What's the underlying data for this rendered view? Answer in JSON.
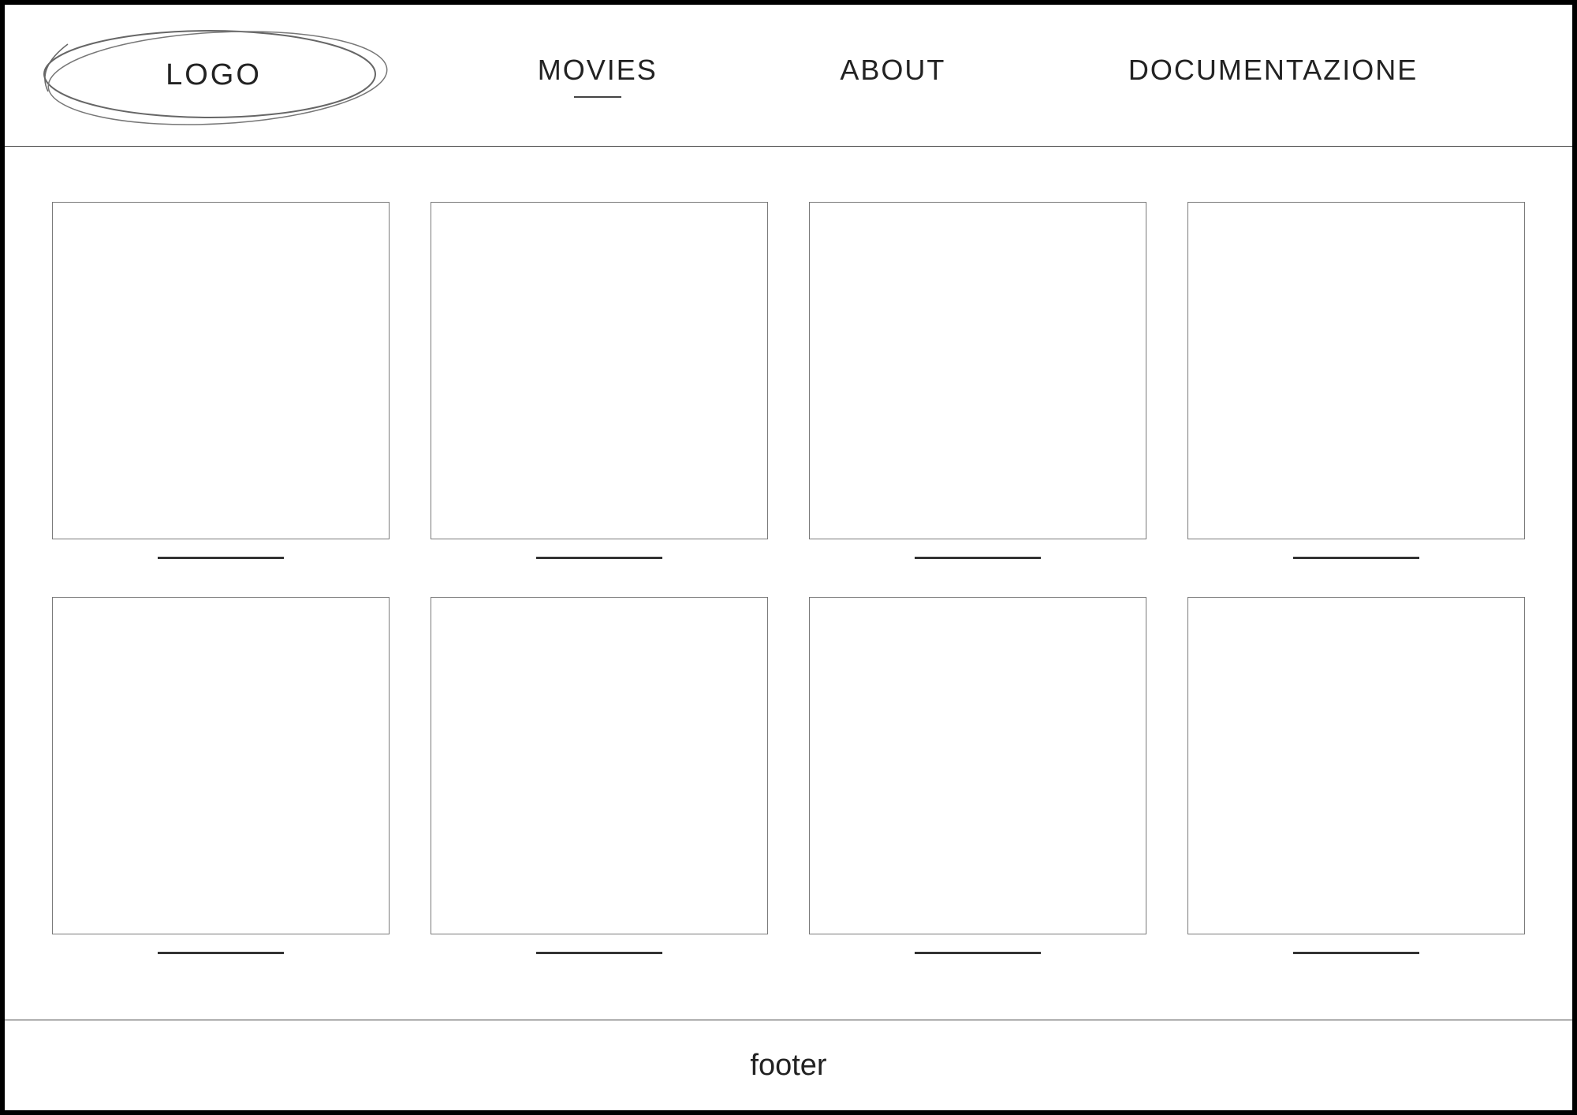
{
  "header": {
    "logo": "LOGO",
    "nav": [
      {
        "label": "MOVIES",
        "active": true
      },
      {
        "label": "ABOUT",
        "active": false
      },
      {
        "label": "DOCUMENTAZIONE",
        "active": false
      }
    ]
  },
  "main": {
    "cards": [
      {
        "title": ""
      },
      {
        "title": ""
      },
      {
        "title": ""
      },
      {
        "title": ""
      },
      {
        "title": ""
      },
      {
        "title": ""
      },
      {
        "title": ""
      },
      {
        "title": ""
      }
    ]
  },
  "footer": {
    "text": "footer"
  }
}
